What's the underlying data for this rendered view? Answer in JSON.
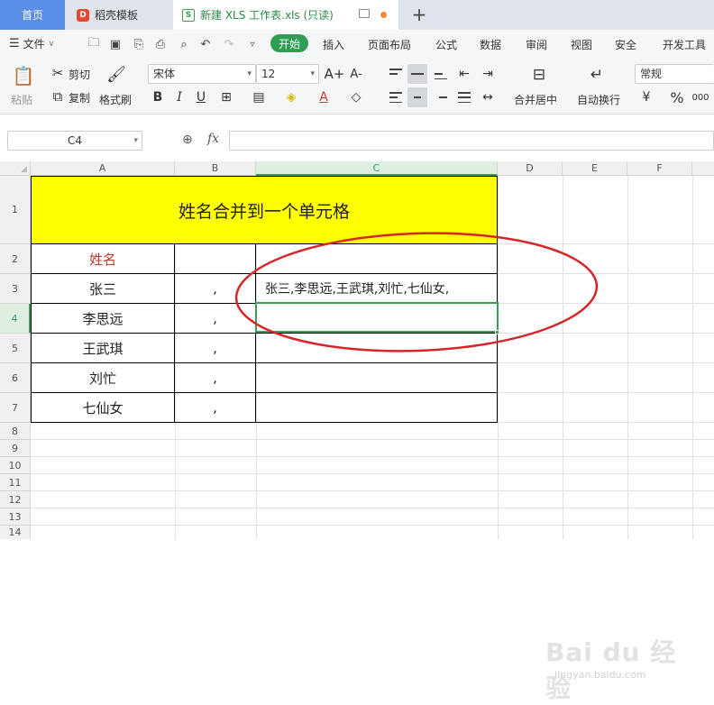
{
  "tabs": {
    "home": "首页",
    "template": "稻壳模板",
    "template_logo": "D",
    "file": "新建 XLS 工作表.xls (只读)",
    "file_logo": "S",
    "add": "+"
  },
  "menu": {
    "file": "文件",
    "start": "开始",
    "items": [
      "插入",
      "页面布局",
      "公式",
      "数据",
      "审阅",
      "视图",
      "安全",
      "开发工具"
    ]
  },
  "ribbon": {
    "paste": "粘贴",
    "cut": "剪切",
    "copy": "复制",
    "format_painter": "格式刷",
    "font_name": "宋体",
    "font_size": "12",
    "merge_center": "合并居中",
    "wrap_text": "自动换行",
    "number_format": "常规",
    "percent": "%",
    "bold": "B",
    "italic": "I",
    "underline": "U",
    "grow_font": "A+",
    "shrink_font": "A-"
  },
  "formula_bar": {
    "name_box": "C4",
    "fx": "fx",
    "value": ""
  },
  "grid": {
    "columns": [
      "A",
      "B",
      "C",
      "D",
      "E",
      "F"
    ],
    "rows": [
      "1",
      "2",
      "3",
      "4",
      "5",
      "6",
      "7",
      "8",
      "9",
      "10",
      "11",
      "12",
      "13",
      "14"
    ],
    "selected_column": "C",
    "selected_row": "4",
    "title": "姓名合并到一个单元格",
    "header_name": "姓名",
    "names": [
      "张三",
      "李思远",
      "王武琪",
      "刘忙",
      "七仙女"
    ],
    "separators": [
      ",",
      ",",
      ",",
      ",",
      ","
    ],
    "merged_result": "张三,李思远,王武琪,刘忙,七仙女,"
  },
  "colors": {
    "accent_green": "#2f9e55",
    "home_tab": "#5b8ee6",
    "title_fill": "#ffff00",
    "annotation_red": "#d6262c"
  },
  "watermark": {
    "main": "Bai du 经验",
    "sub": "jingyan.baidu.com"
  }
}
